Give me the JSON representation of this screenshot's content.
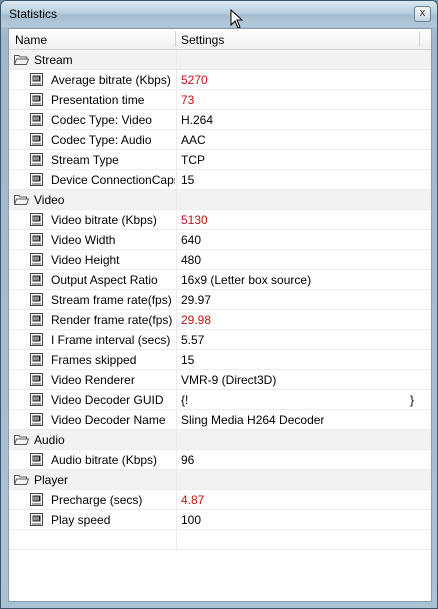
{
  "window": {
    "title": "Statistics",
    "close_label": "x"
  },
  "columns": {
    "name": "Name",
    "settings": "Settings"
  },
  "groups": [
    {
      "label": "Stream",
      "items": [
        {
          "name": "Average bitrate (Kbps)",
          "value": "5270",
          "highlight": true
        },
        {
          "name": "Presentation time",
          "value": "73",
          "highlight": true
        },
        {
          "name": "Codec Type: Video",
          "value": "H.264",
          "highlight": false
        },
        {
          "name": "Codec Type: Audio",
          "value": "AAC",
          "highlight": false
        },
        {
          "name": "Stream Type",
          "value": "TCP",
          "highlight": false
        },
        {
          "name": "Device ConnectionCaps",
          "value": "15",
          "highlight": false
        }
      ]
    },
    {
      "label": "Video",
      "items": [
        {
          "name": "Video bitrate (Kbps)",
          "value": "5130",
          "highlight": true
        },
        {
          "name": "Video Width",
          "value": "640",
          "highlight": false
        },
        {
          "name": "Video Height",
          "value": "480",
          "highlight": false
        },
        {
          "name": "Output Aspect Ratio",
          "value": "16x9 (Letter box source)",
          "highlight": false
        },
        {
          "name": "Stream frame rate(fps)",
          "value": "29.97",
          "highlight": false
        },
        {
          "name": "Render frame rate(fps)",
          "value": "29.98",
          "highlight": true
        },
        {
          "name": "I Frame interval (secs)",
          "value": "5.57",
          "highlight": false
        },
        {
          "name": "Frames skipped",
          "value": "15",
          "highlight": false
        },
        {
          "name": "Video Renderer",
          "value": "VMR-9 (Direct3D)",
          "highlight": false
        },
        {
          "name": "Video Decoder GUID",
          "value": "{!",
          "value_end": "}",
          "highlight": false
        },
        {
          "name": "Video Decoder Name",
          "value": "Sling Media H264 Decoder",
          "highlight": false
        }
      ]
    },
    {
      "label": "Audio",
      "items": [
        {
          "name": "Audio bitrate (Kbps)",
          "value": "96",
          "highlight": false
        }
      ]
    },
    {
      "label": "Player",
      "items": [
        {
          "name": "Precharge (secs)",
          "value": "4.87",
          "highlight": true
        },
        {
          "name": "Play speed",
          "value": "100",
          "highlight": false
        }
      ]
    }
  ],
  "colors": {
    "highlight_value": "#c41212",
    "group_row_bg": "#f2f2f2"
  },
  "icons": {
    "group": "open-folder-icon",
    "item": "stat-item-icon",
    "close": "close-icon"
  }
}
